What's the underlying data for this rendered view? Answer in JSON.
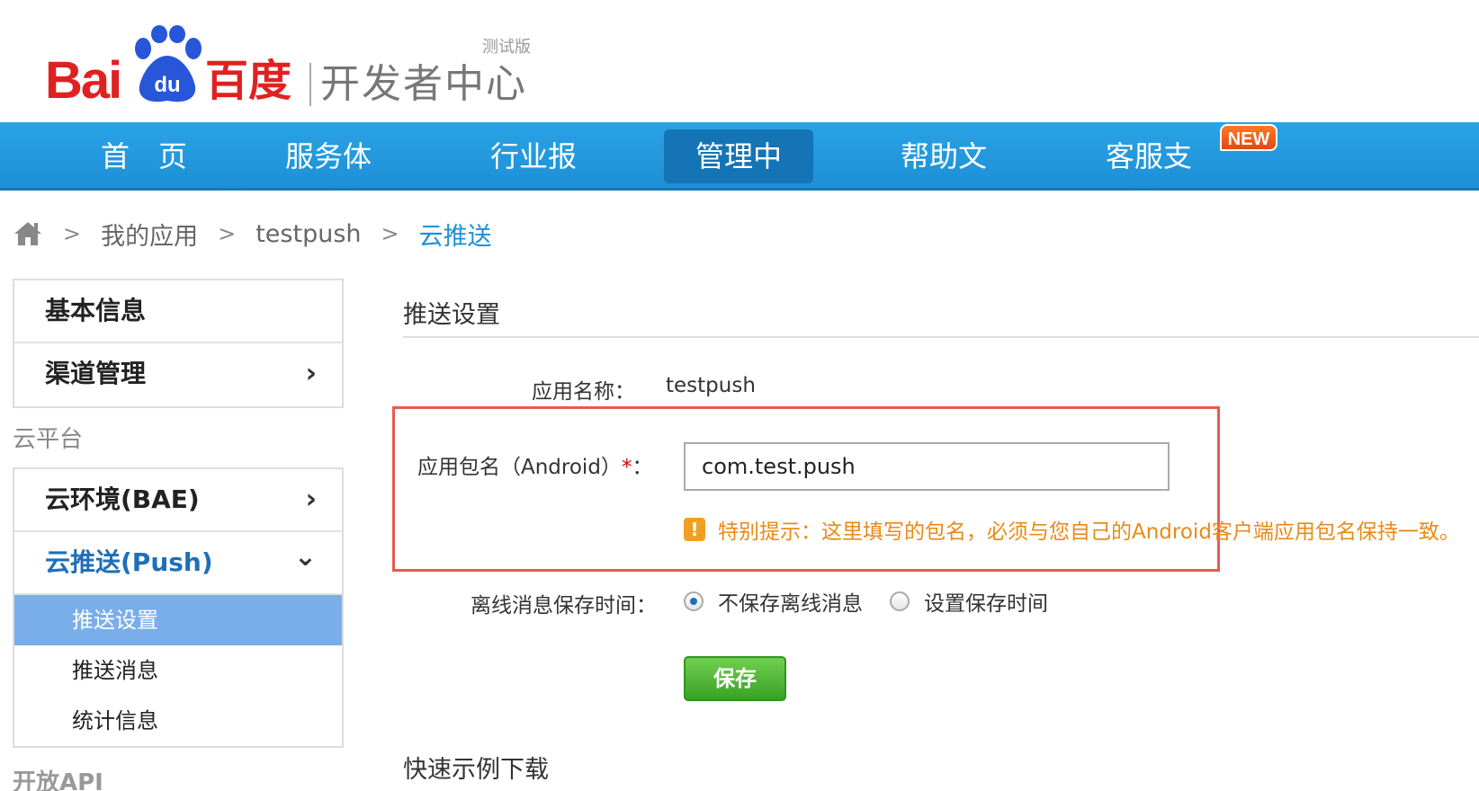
{
  "logo": {
    "bai": "Bai",
    "du": "du",
    "baidu_cn": "百度",
    "subtitle": "开发者中心",
    "beta": "测试版"
  },
  "nav": {
    "items": [
      "首　页",
      "服务体系",
      "行业报告",
      "管理中心",
      "帮助文档",
      "客服支持"
    ],
    "active_index": 3,
    "new_badge": "NEW"
  },
  "breadcrumb": {
    "items": [
      "我的应用",
      "testpush",
      "云推送"
    ],
    "separator": ">"
  },
  "sidebar": {
    "top_items": [
      {
        "label": "基本信息"
      },
      {
        "label": "渠道管理",
        "chevron": "›"
      }
    ],
    "section_cloud": "云平台",
    "cloud_items": [
      {
        "label": "云环境(BAE)",
        "chevron": "›"
      },
      {
        "label": "云推送(Push)",
        "chevron": "⌄"
      }
    ],
    "push_subitems": [
      "推送设置",
      "推送消息",
      "统计信息"
    ],
    "section_api": "开放API"
  },
  "main": {
    "section_title": "推送设置",
    "app_name_label": "应用名称：",
    "app_name_value": "testpush",
    "package_label": "应用包名（Android）",
    "required_mark": "*",
    "package_colon": "：",
    "package_value": "com.test.push",
    "warning_icon": "!",
    "warning_text": "特别提示：这里填写的包名，必须与您自己的Android客户端应用包名保持一致。",
    "offline_label": "离线消息保存时间：",
    "radio_options": [
      "不保存离线消息",
      "设置保存时间"
    ],
    "radio_selected": 0,
    "save_label": "保存",
    "download_title": "快速示例下载"
  },
  "colors": {
    "nav_blue": "#1e8fd6",
    "highlight_red": "#e85a4f",
    "warning_orange": "#e98a17",
    "save_green": "#3aa028",
    "logo_red": "#e02121"
  }
}
